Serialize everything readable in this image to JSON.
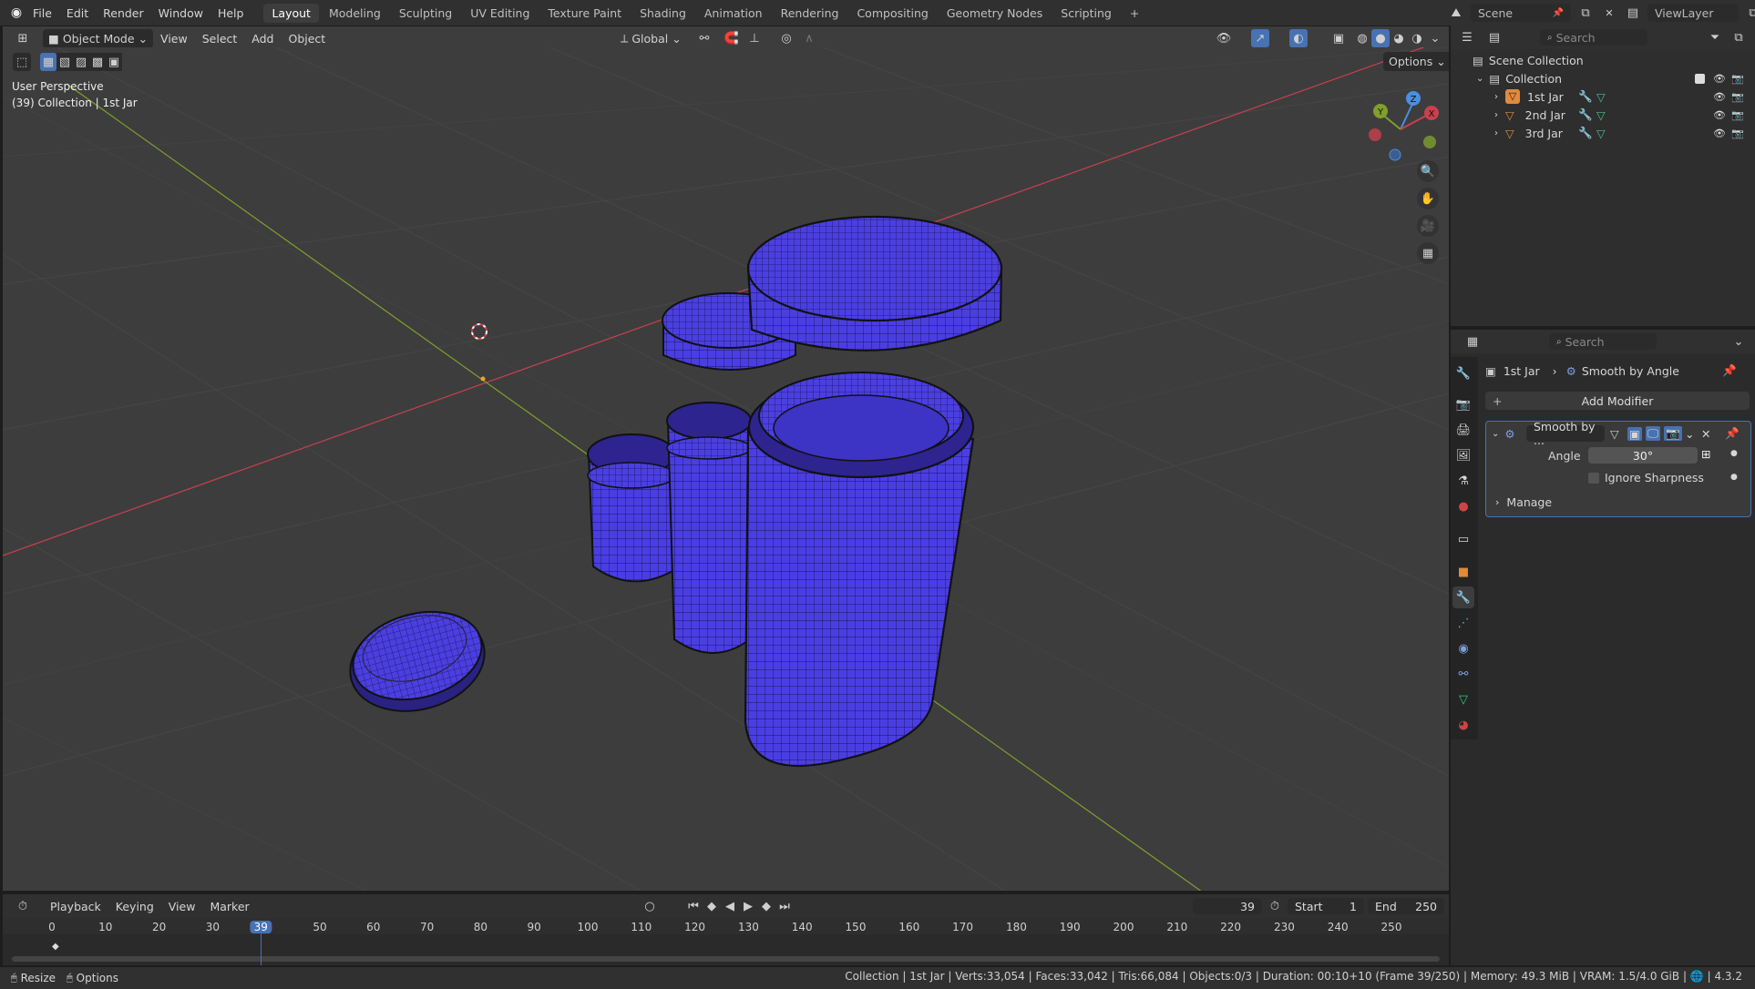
{
  "topbar": {
    "menus": [
      "File",
      "Edit",
      "Render",
      "Window",
      "Help"
    ],
    "workspaces": [
      "Layout",
      "Modeling",
      "Sculpting",
      "UV Editing",
      "Texture Paint",
      "Shading",
      "Animation",
      "Rendering",
      "Compositing",
      "Geometry Nodes",
      "Scripting"
    ],
    "active_workspace": "Layout",
    "add_tab": "+",
    "scene": "Scene",
    "view_layer": "ViewLayer"
  },
  "viewport_header": {
    "mode": "Object Mode",
    "menus": [
      "View",
      "Select",
      "Add",
      "Object"
    ],
    "transform_orientation": "Global",
    "options": "Options"
  },
  "viewport": {
    "perspective": "User Perspective",
    "collection_info": "(39) Collection | 1st Jar",
    "gizmo": {
      "x": "X",
      "y": "Y",
      "z": "Z"
    }
  },
  "outliner": {
    "search_placeholder": "Search",
    "scene_collection": "Scene Collection",
    "collection": "Collection",
    "items": [
      "1st Jar",
      "2nd Jar",
      "3rd Jar"
    ]
  },
  "properties": {
    "search_placeholder": "Search",
    "breadcrumb_object": "1st Jar",
    "breadcrumb_modifier": "Smooth by Angle",
    "add_modifier": "Add Modifier",
    "modifier_name": "Smooth by ...",
    "angle_label": "Angle",
    "angle_value": "30°",
    "ignore_sharpness": "Ignore Sharpness",
    "manage": "Manage"
  },
  "timeline": {
    "menus": [
      "Playback",
      "Keying",
      "View",
      "Marker"
    ],
    "current_frame": "39",
    "start_label": "Start",
    "start_value": "1",
    "end_label": "End",
    "end_value": "250",
    "ticks": [
      "0",
      "10",
      "20",
      "30",
      "39",
      "50",
      "60",
      "70",
      "80",
      "90",
      "100",
      "110",
      "120",
      "130",
      "140",
      "150",
      "160",
      "170",
      "180",
      "190",
      "200",
      "210",
      "220",
      "230",
      "240",
      "250"
    ]
  },
  "statusbar": {
    "left1": "Resize",
    "left2": "Options",
    "info": "Collection | 1st Jar | Verts:33,054 | Faces:33,042 | Tris:66,084 | Objects:0/3 | Duration: 00:10+10 (Frame 39/250) | Memory: 49.3 MiB | VRAM: 1.5/4.0 GiB | ",
    "version": "4.3.2"
  },
  "colors": {
    "accent": "#4772b3",
    "mesh": "#4b3fe0",
    "x_axis": "#c9404e",
    "y_axis": "#7ea02c"
  }
}
